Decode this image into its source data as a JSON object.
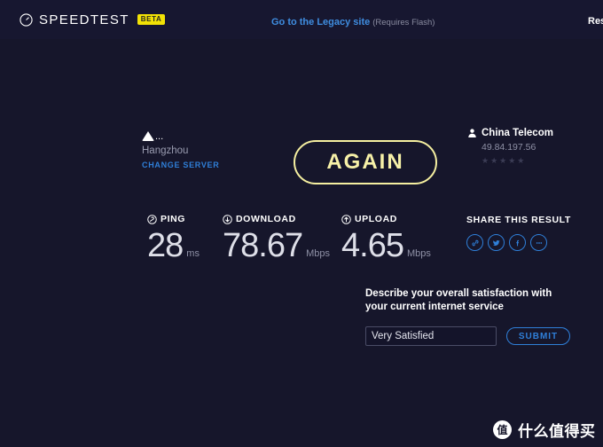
{
  "header": {
    "logo_text": "SPEEDTEST",
    "logo_icon": "speedometer-icon",
    "beta_badge": "BETA",
    "legacy_link": "Go to the Legacy site",
    "legacy_note": "(Requires Flash)",
    "results_link": "Res"
  },
  "server": {
    "provider_mark": "triangle-mark-icon",
    "provider_truncated": "...",
    "city": "Hangzhou",
    "change_server": "CHANGE SERVER"
  },
  "again_button": {
    "label": "AGAIN"
  },
  "isp": {
    "icon": "person-icon",
    "name": "China Telecom",
    "ip": "49.84.197.56",
    "stars": "★★★★★",
    "star_count": 5,
    "rating": 0
  },
  "metrics": [
    {
      "key": "ping",
      "icon": "ping-icon",
      "label": "PING",
      "value": "28",
      "unit": "ms"
    },
    {
      "key": "download",
      "icon": "download-arrow-icon",
      "label": "DOWNLOAD",
      "value": "78.67",
      "unit": "Mbps"
    },
    {
      "key": "upload",
      "icon": "upload-arrow-icon",
      "label": "UPLOAD",
      "value": "4.65",
      "unit": "Mbps"
    }
  ],
  "share": {
    "title": "SHARE THIS RESULT",
    "icons": [
      "link-icon",
      "twitter-icon",
      "facebook-icon",
      "more-icon"
    ]
  },
  "survey": {
    "question_line1": "Describe your overall satisfaction with",
    "question_line2": "your current internet service",
    "selected_value": "Very Satisfied",
    "options": [
      "Very Satisfied"
    ],
    "submit_label": "SUBMIT"
  },
  "watermark": {
    "badge": "值",
    "text": "什么值得买"
  },
  "colors": {
    "background": "#16162b",
    "header_background": "#171730",
    "accent_blue": "#2f7fd8",
    "accent_yellow": "#f5efa0",
    "badge_yellow": "#f2e205",
    "value_text": "#dedfe8",
    "muted_text": "#8f91a6"
  }
}
